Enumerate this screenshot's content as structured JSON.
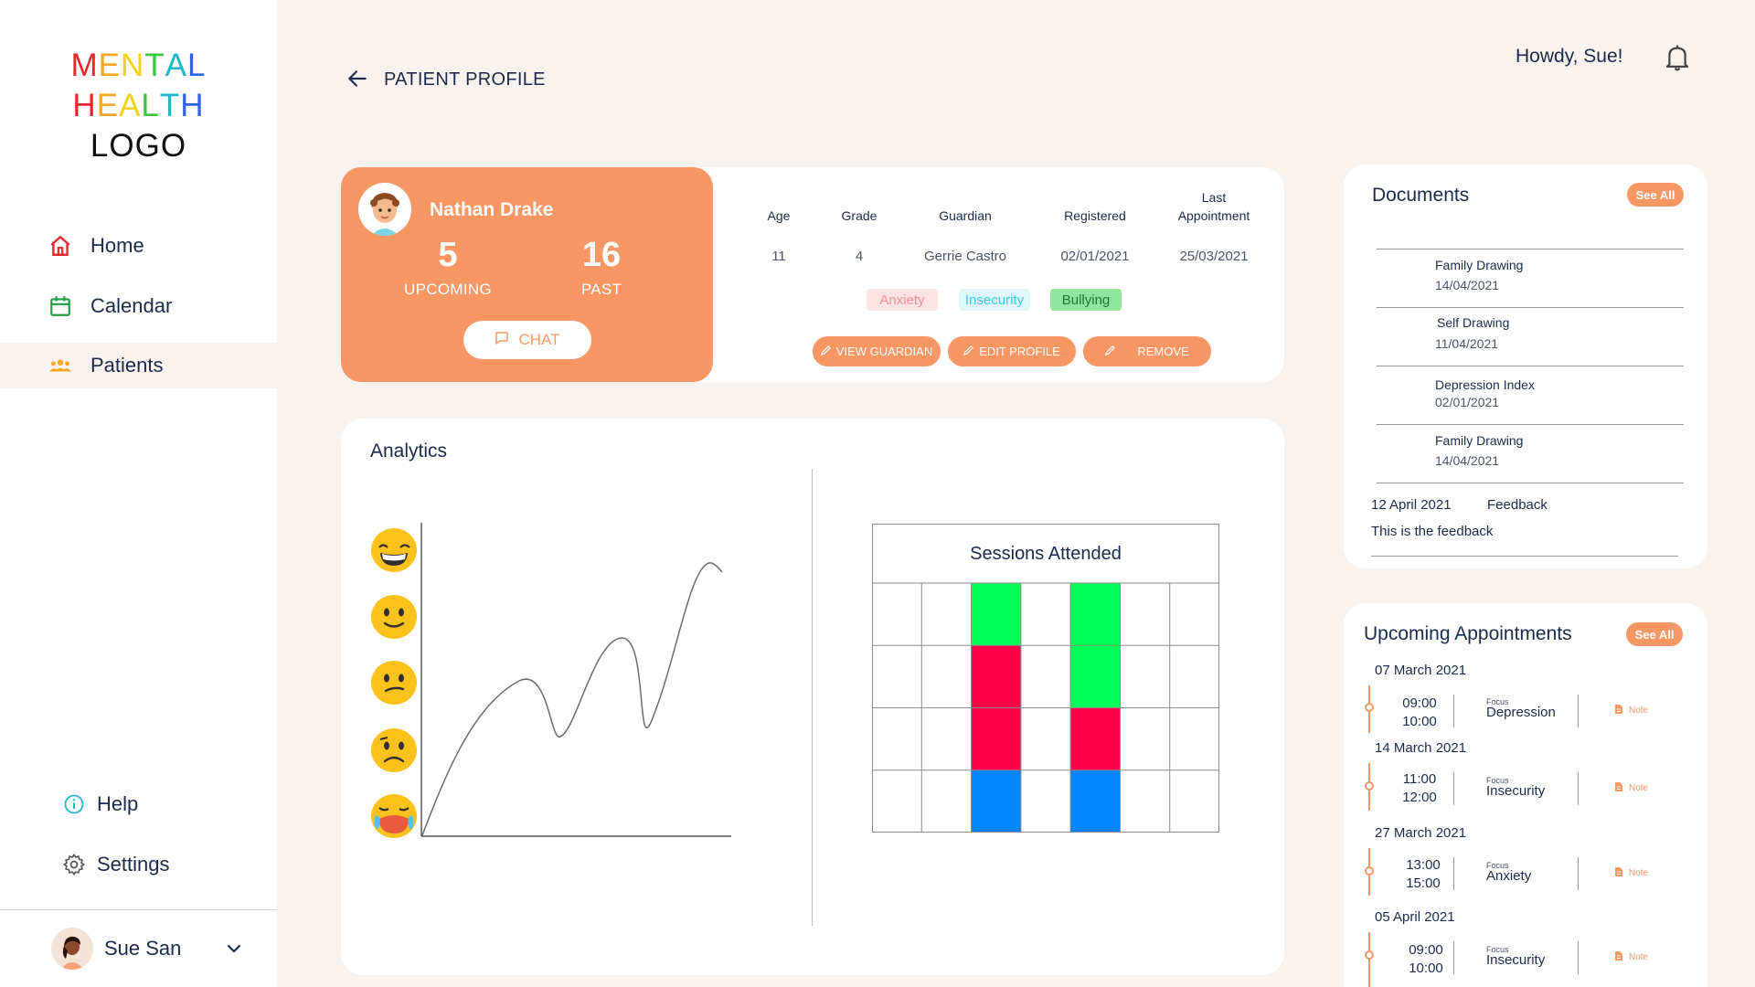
{
  "logo": {
    "line1": "MENTAL",
    "line2": "HEALTH",
    "line3": "LOGO"
  },
  "nav": {
    "home": "Home",
    "calendar": "Calendar",
    "patients": "Patients",
    "help": "Help",
    "settings": "Settings"
  },
  "user": {
    "name": "Sue San"
  },
  "header": {
    "title": "PATIENT PROFILE",
    "greeting": "Howdy, Sue!"
  },
  "patient": {
    "name": "Nathan Drake",
    "upcoming_count": "5",
    "upcoming_label": "UPCOMING",
    "past_count": "16",
    "past_label": "PAST",
    "chat_label": "CHAT",
    "headers": {
      "age": "Age",
      "grade": "Grade",
      "guardian": "Guardian",
      "registered": "Registered",
      "last_appt_1": "Last",
      "last_appt_2": "Appointment"
    },
    "values": {
      "age": "11",
      "grade": "4",
      "guardian": "Gerrie Castro",
      "registered": "02/01/2021",
      "last_appt": "25/03/2021"
    },
    "tags": [
      {
        "label": "Anxiety",
        "color": "#f58d93",
        "bg": "#fde3e4"
      },
      {
        "label": "Insecurity",
        "color": "#38c8f2",
        "bg": "#e0f7fd"
      },
      {
        "label": "Bullying",
        "color": "#1b7a2e",
        "bg": "#8ee59b"
      }
    ],
    "actions": {
      "view_guardian": "VIEW GUARDIAN",
      "edit_profile": "EDIT PROFILE",
      "remove": "REMOVE"
    }
  },
  "analytics": {
    "title": "Analytics",
    "mood_scale": [
      "grinning-face",
      "slightly-smiling-face",
      "neutral-face",
      "confused-face",
      "crying-face"
    ],
    "sessions": {
      "title": "Sessions Attended",
      "columns": 7,
      "rows": 4,
      "filled": [
        {
          "col": 2,
          "cells": [
            "#00ff55",
            "#ff0048",
            "#ff0048",
            "#0084ff"
          ]
        },
        {
          "col": 4,
          "cells": [
            "#00ff55",
            "#00ff55",
            "#ff0048",
            "#0084ff"
          ]
        }
      ]
    }
  },
  "documents": {
    "title": "Documents",
    "see_all": "See All",
    "items": [
      {
        "name": "Family Drawing",
        "date": "14/04/2021"
      },
      {
        "name": "Self Drawing",
        "date": "11/04/2021"
      },
      {
        "name": "Depression Index",
        "date": "02/01/2021"
      },
      {
        "name": "Family Drawing",
        "date": "14/04/2021"
      }
    ],
    "feedback": {
      "date": "12 April 2021",
      "label": "Feedback",
      "text": "This is the feedback"
    }
  },
  "appointments": {
    "title": "Upcoming Appointments",
    "see_all": "See All",
    "focus_label": "Focus",
    "note_label": "Note",
    "items": [
      {
        "date": "07 March 2021",
        "start": "09:00",
        "end": "10:00",
        "focus": "Depression"
      },
      {
        "date": "14 March 2021",
        "start": "11:00",
        "end": "12:00",
        "focus": "Insecurity"
      },
      {
        "date": "27 March 2021",
        "start": "13:00",
        "end": "15:00",
        "focus": "Anxiety"
      },
      {
        "date": "05 April 2021",
        "start": "09:00",
        "end": "10:00",
        "focus": "Insecurity"
      }
    ]
  },
  "colors": {
    "accent": "#f89664",
    "navy": "#1b2a4a",
    "background": "#f9f3ef"
  }
}
